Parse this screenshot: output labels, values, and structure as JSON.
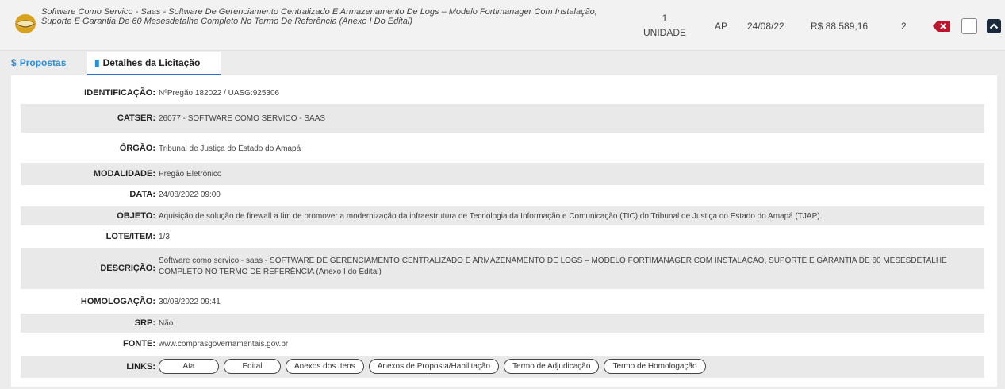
{
  "item": {
    "title": "Software Como Servico - Saas - Software De Gerenciamento Centralizado E Armazenamento De Logs – Modelo Fortimanager Com Instalação, Suporte E Garantia De 60 Mesesdetalhe Completo No Termo De Referência (Anexo I Do Edital)",
    "qty_number": "1",
    "qty_unit": "UNIDADE",
    "uf": "AP",
    "date": "24/08/22",
    "value": "R$ 88.589,16",
    "count": "2"
  },
  "tabs": {
    "propostas": "Propostas",
    "detalhes": "Detalhes da Licitação"
  },
  "details": {
    "identificacao_label": "IDENTIFICAÇÃO:",
    "identificacao": "NºPregão:182022 / UASG:925306",
    "catser_label": "CATSER:",
    "catser": "26077 - SOFTWARE COMO SERVICO - SAAS",
    "orgao_label": "ÓRGÃO:",
    "orgao": "Tribunal de Justiça do Estado do Amapá",
    "modalidade_label": "MODALIDADE:",
    "modalidade": "Pregão Eletrônico",
    "data_label": "DATA:",
    "data": "24/08/2022 09:00",
    "objeto_label": "OBJETO:",
    "objeto": "Aquisição de solução de firewall a fim de promover a modernização da infraestrutura de Tecnologia da Informação e Comunicação (TIC) do Tribunal de Justiça do Estado do Amapá (TJAP).",
    "lote_label": "LOTE/ITEM:",
    "lote": "1/3",
    "descricao_label": "DESCRIÇÃO:",
    "descricao": "Software como servico - saas - SOFTWARE DE GERENCIAMENTO CENTRALIZADO E ARMAZENAMENTO DE LOGS – MODELO FORTIMANAGER COM INSTALAÇÃO, SUPORTE E GARANTIA DE 60 MESESDETALHE COMPLETO NO TERMO DE REFERÊNCIA (Anexo I do Edital)",
    "homologacao_label": "HOMOLOGAÇÃO:",
    "homologacao": "30/08/2022 09:41",
    "srp_label": "SRP:",
    "srp": "Não",
    "fonte_label": "FONTE:",
    "fonte": "www.comprasgovernamentais.gov.br",
    "links_label": "LINKS:",
    "links": [
      "Ata",
      "Edital",
      "Anexos dos Itens",
      "Anexos de Proposta/Habilitação",
      "Termo de Adjudicação",
      "Termo de Homologação"
    ]
  },
  "colors": {
    "accent_tab": "#2a6fd6",
    "propostas_link": "#2a8fd6",
    "delete": "#c0152f",
    "row_shade": "#e9e9e9"
  }
}
